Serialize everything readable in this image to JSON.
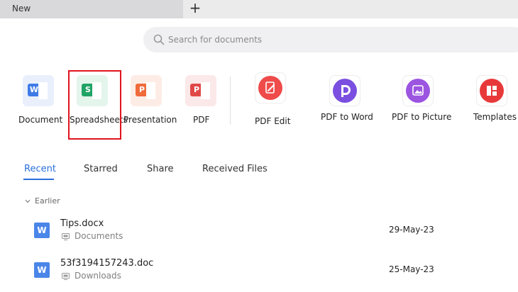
{
  "tabbar": {
    "tab_label": "New",
    "add_label": "+"
  },
  "search": {
    "placeholder": "Search for documents",
    "value": ""
  },
  "quick_create": [
    {
      "label": "Document",
      "icon": "word-icon",
      "badge": "W"
    },
    {
      "label": "Spreadsheets",
      "icon": "spreadsheet-icon",
      "badge": "S"
    },
    {
      "label": "Presentation",
      "icon": "presentation-icon",
      "badge": "P"
    },
    {
      "label": "PDF",
      "icon": "pdf-icon",
      "badge": "P"
    },
    {
      "label": "PDF Edit",
      "icon": "pdf-edit-icon"
    },
    {
      "label": "PDF to Word",
      "icon": "pdf-to-word-icon"
    },
    {
      "label": "PDF to Picture",
      "icon": "pdf-to-picture-icon"
    },
    {
      "label": "Templates",
      "icon": "templates-icon"
    }
  ],
  "file_tabs": [
    "Recent",
    "Starred",
    "Share",
    "Received Files"
  ],
  "active_tab": "Recent",
  "group_label": "Earlier",
  "files": [
    {
      "name": "Tips.docx",
      "location": "Documents",
      "date": "29-May-23",
      "icon": "W"
    },
    {
      "name": "53f3194157243.doc",
      "location": "Downloads",
      "date": "25-May-23",
      "icon": "W"
    }
  ],
  "colors": {
    "accent": "#2a6fdb",
    "highlight": "#e0141e",
    "word": "#4a85e8",
    "sheet": "#21a366",
    "presentation": "#f06a3c",
    "pdf": "#e04848",
    "pdf_edit": "#ef4b4b",
    "pdf_to_word": "#7b4fe0",
    "pdf_to_picture": "#9b55e0",
    "templates": "#e8393a"
  }
}
